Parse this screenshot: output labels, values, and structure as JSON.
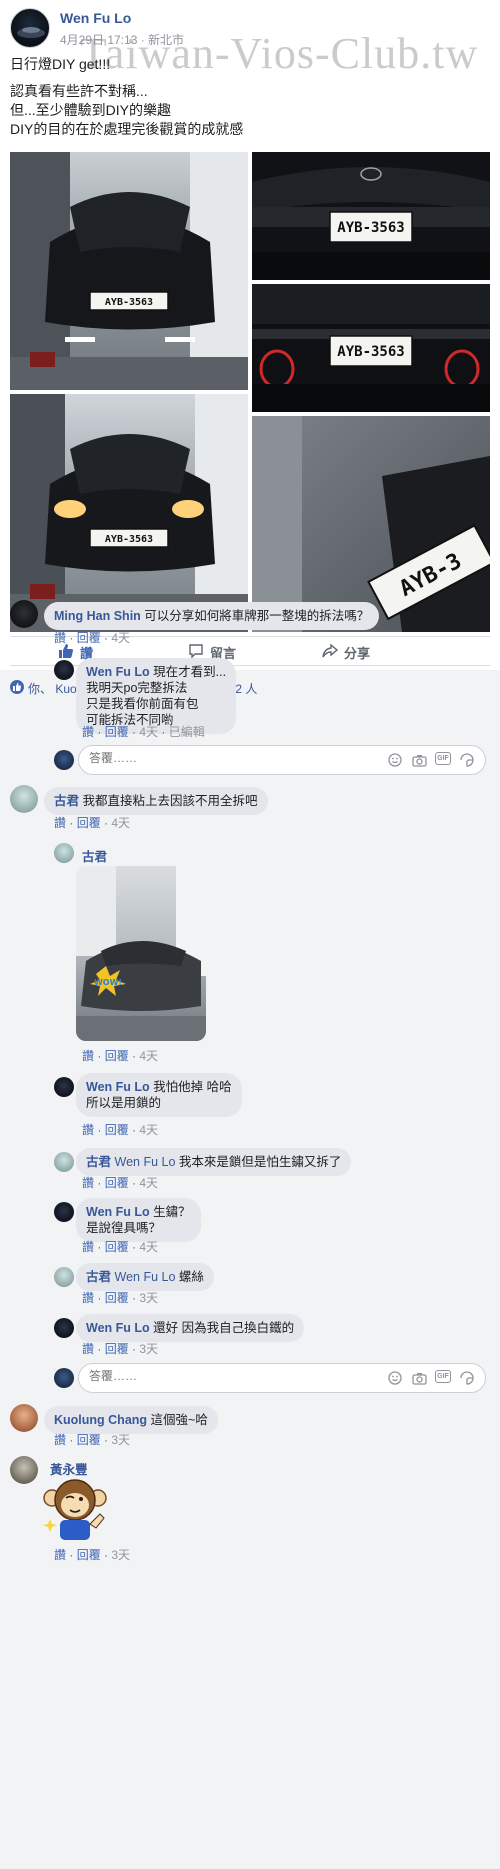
{
  "watermark": "Taiwan-Vios-Club.tw",
  "post": {
    "author": "Wen Fu Lo",
    "meta": "4月29日 17:13 · 新北市",
    "lines": [
      "日行燈DIY get!!!",
      "",
      "認真看有些許不對稱...",
      "但...至少體驗到DIY的樂趣",
      "DIY的目的在於處理完後觀賞的成就感"
    ],
    "plate_text": "AYB-3563",
    "plate_partial": "AYB-3"
  },
  "actions": {
    "like": "讚",
    "comment": "留言",
    "share": "分享"
  },
  "reactions": {
    "text": "你、 Kuolung Chang 、丁冠翔和其他 22 人"
  },
  "comment_links": {
    "like": "讚",
    "reply": "回覆",
    "edited": "已編輯"
  },
  "reply_box": {
    "placeholder": "答覆……",
    "gif": "GIF"
  },
  "comments": [
    {
      "author": "Ming Han Shin",
      "text": "可以分享如何將車牌那一整塊的拆法嗎？",
      "time": "4天"
    },
    {
      "author": "Wen Fu Lo",
      "lines": [
        "現在才看到...",
        "我明天po完整拆法",
        "只是我看你前面有包",
        "可能拆法不同喲"
      ],
      "time": "4天"
    },
    {
      "author": "古君",
      "text": "我都直接粘上去因該不用全拆吧",
      "time": "4天"
    },
    {
      "author": "古君",
      "time": "4天",
      "sticker_text": "WOW!"
    },
    {
      "author": "Wen Fu Lo",
      "lines": [
        "我怕他掉 哈哈",
        "所以是用鎖的"
      ],
      "time": "4天"
    },
    {
      "author": "古君",
      "mention": "Wen Fu Lo",
      "text": "我本來是鎖但是怕生鏽又拆了",
      "time": "4天"
    },
    {
      "author": "Wen Fu Lo",
      "lines": [
        "生鏽？",
        "是說徨具嗎？"
      ],
      "time": "4天"
    },
    {
      "author": "古君",
      "mention": "Wen Fu Lo",
      "text": "螺絲",
      "time": "3天"
    },
    {
      "author": "Wen Fu Lo",
      "text": "還好 因為我自己換白鐵的",
      "time": "3天"
    },
    {
      "author": "Kuolung Chang",
      "text": "這個強~哈",
      "time": "3天"
    },
    {
      "author": "黃永豐",
      "time": "3天"
    }
  ],
  "colors": {
    "link_blue": "#385898",
    "action_blue": "#4267b2",
    "bubble_gray": "#e4e6eb",
    "bg_gray": "#f2f3f5"
  },
  "icons": [
    "thumbs-up-icon",
    "comment-icon",
    "share-icon",
    "emoji-icon",
    "camera-icon",
    "gif-icon",
    "sticker-icon"
  ]
}
